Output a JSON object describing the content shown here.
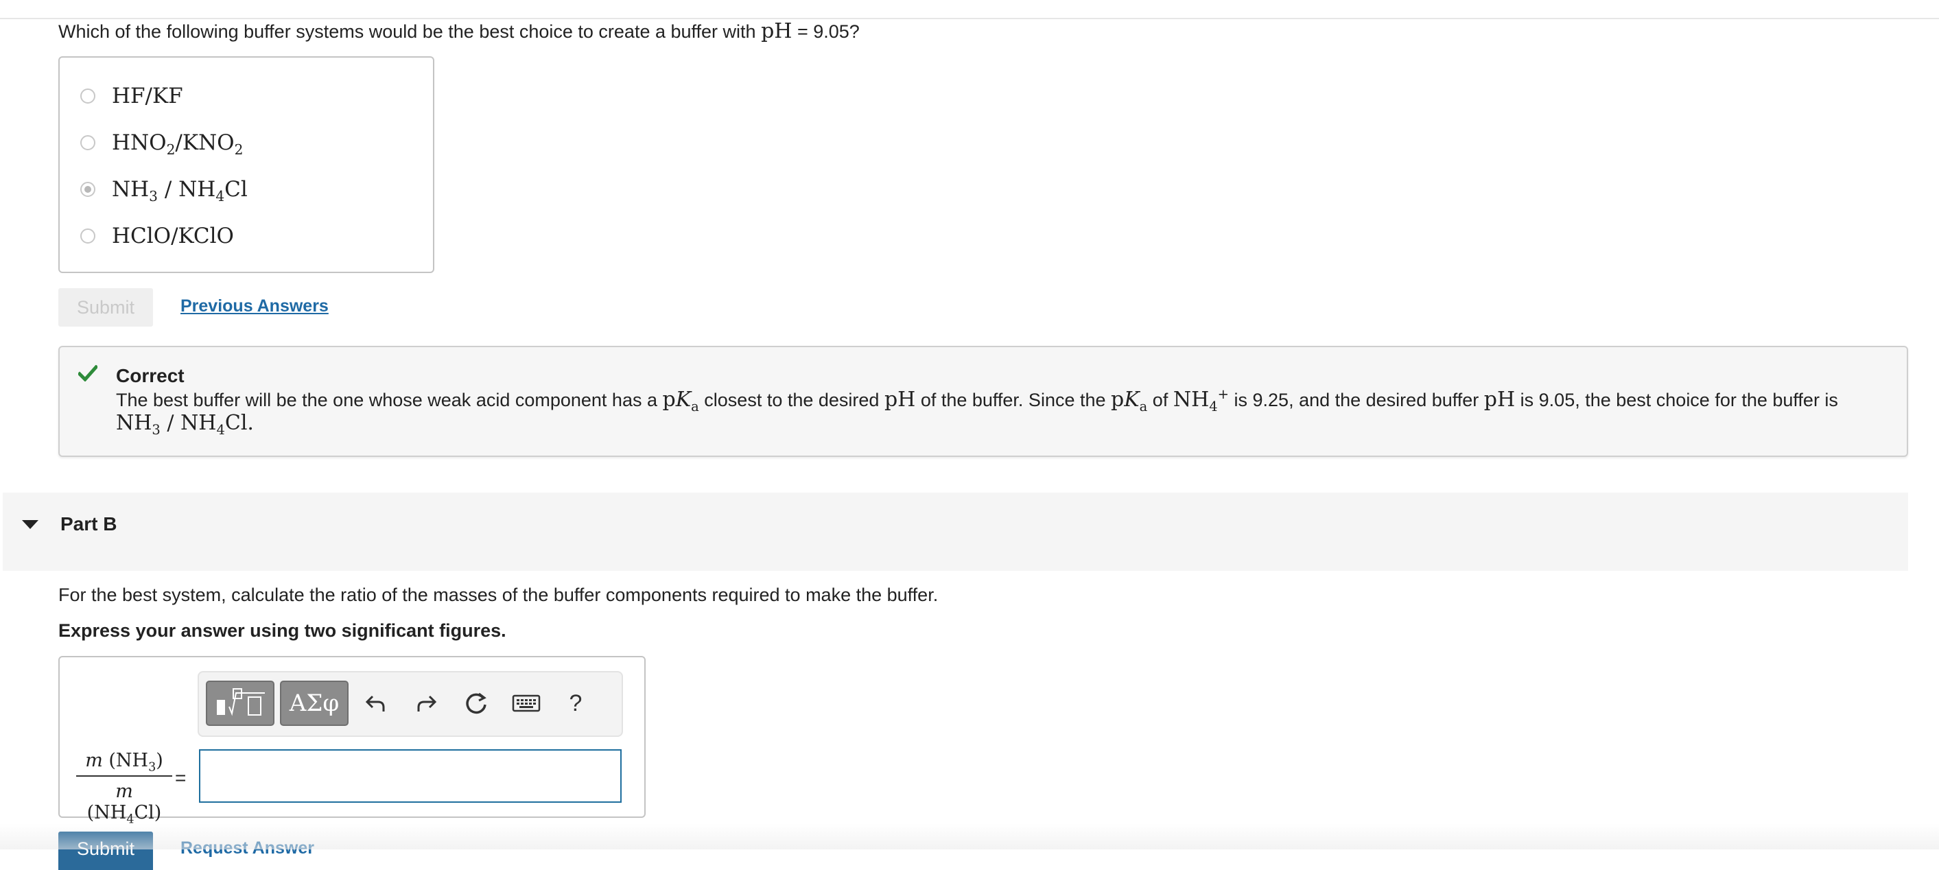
{
  "part_a": {
    "question_before": "Which of the following buffer systems would be the best choice to create a buffer with ",
    "question_math": "pH",
    "question_after": " = 9.05?",
    "choices": [
      {
        "label": "HF/KF",
        "selected": false
      },
      {
        "label": "HNO2/KNO2",
        "selected": false
      },
      {
        "label": "NH3/NH4Cl",
        "selected": true
      },
      {
        "label": "HClO/KClO",
        "selected": false
      }
    ],
    "submit_label": "Submit",
    "previous_answers_label": "Previous Answers"
  },
  "feedback": {
    "status": "Correct",
    "text": {
      "t1": "The best buffer will be the one whose weak acid component has a ",
      "t2": " closest to the desired ",
      "t3": " of the buffer. Since the ",
      "t4": " of ",
      "t5": " is 9.25, and the desired buffer ",
      "t6": " is 9.05, the best choice for the buffer is",
      "ph": "pH",
      "pka_p": "p",
      "pka_k": "K",
      "pka_sub": "a",
      "nh4": "NH",
      "nh4_sub": "4",
      "nh4_sup": "+",
      "answer": "NH3/NH4Cl."
    },
    "accent_color": "#2e8b3a"
  },
  "part_b": {
    "title": "Part B",
    "prompt": "For the best system, calculate the ratio of the masses of the buffer components required to make the buffer.",
    "instruction": "Express your answer using two significant figures.",
    "toolbar": {
      "symbols_label": "ΑΣφ",
      "help_label": "?"
    },
    "fraction": {
      "numerator": "m (NH3)",
      "denominator": "m (NH4Cl)"
    },
    "equals": "=",
    "answer_value": "",
    "submit_label": "Submit",
    "request_answer_label": "Request Answer"
  }
}
